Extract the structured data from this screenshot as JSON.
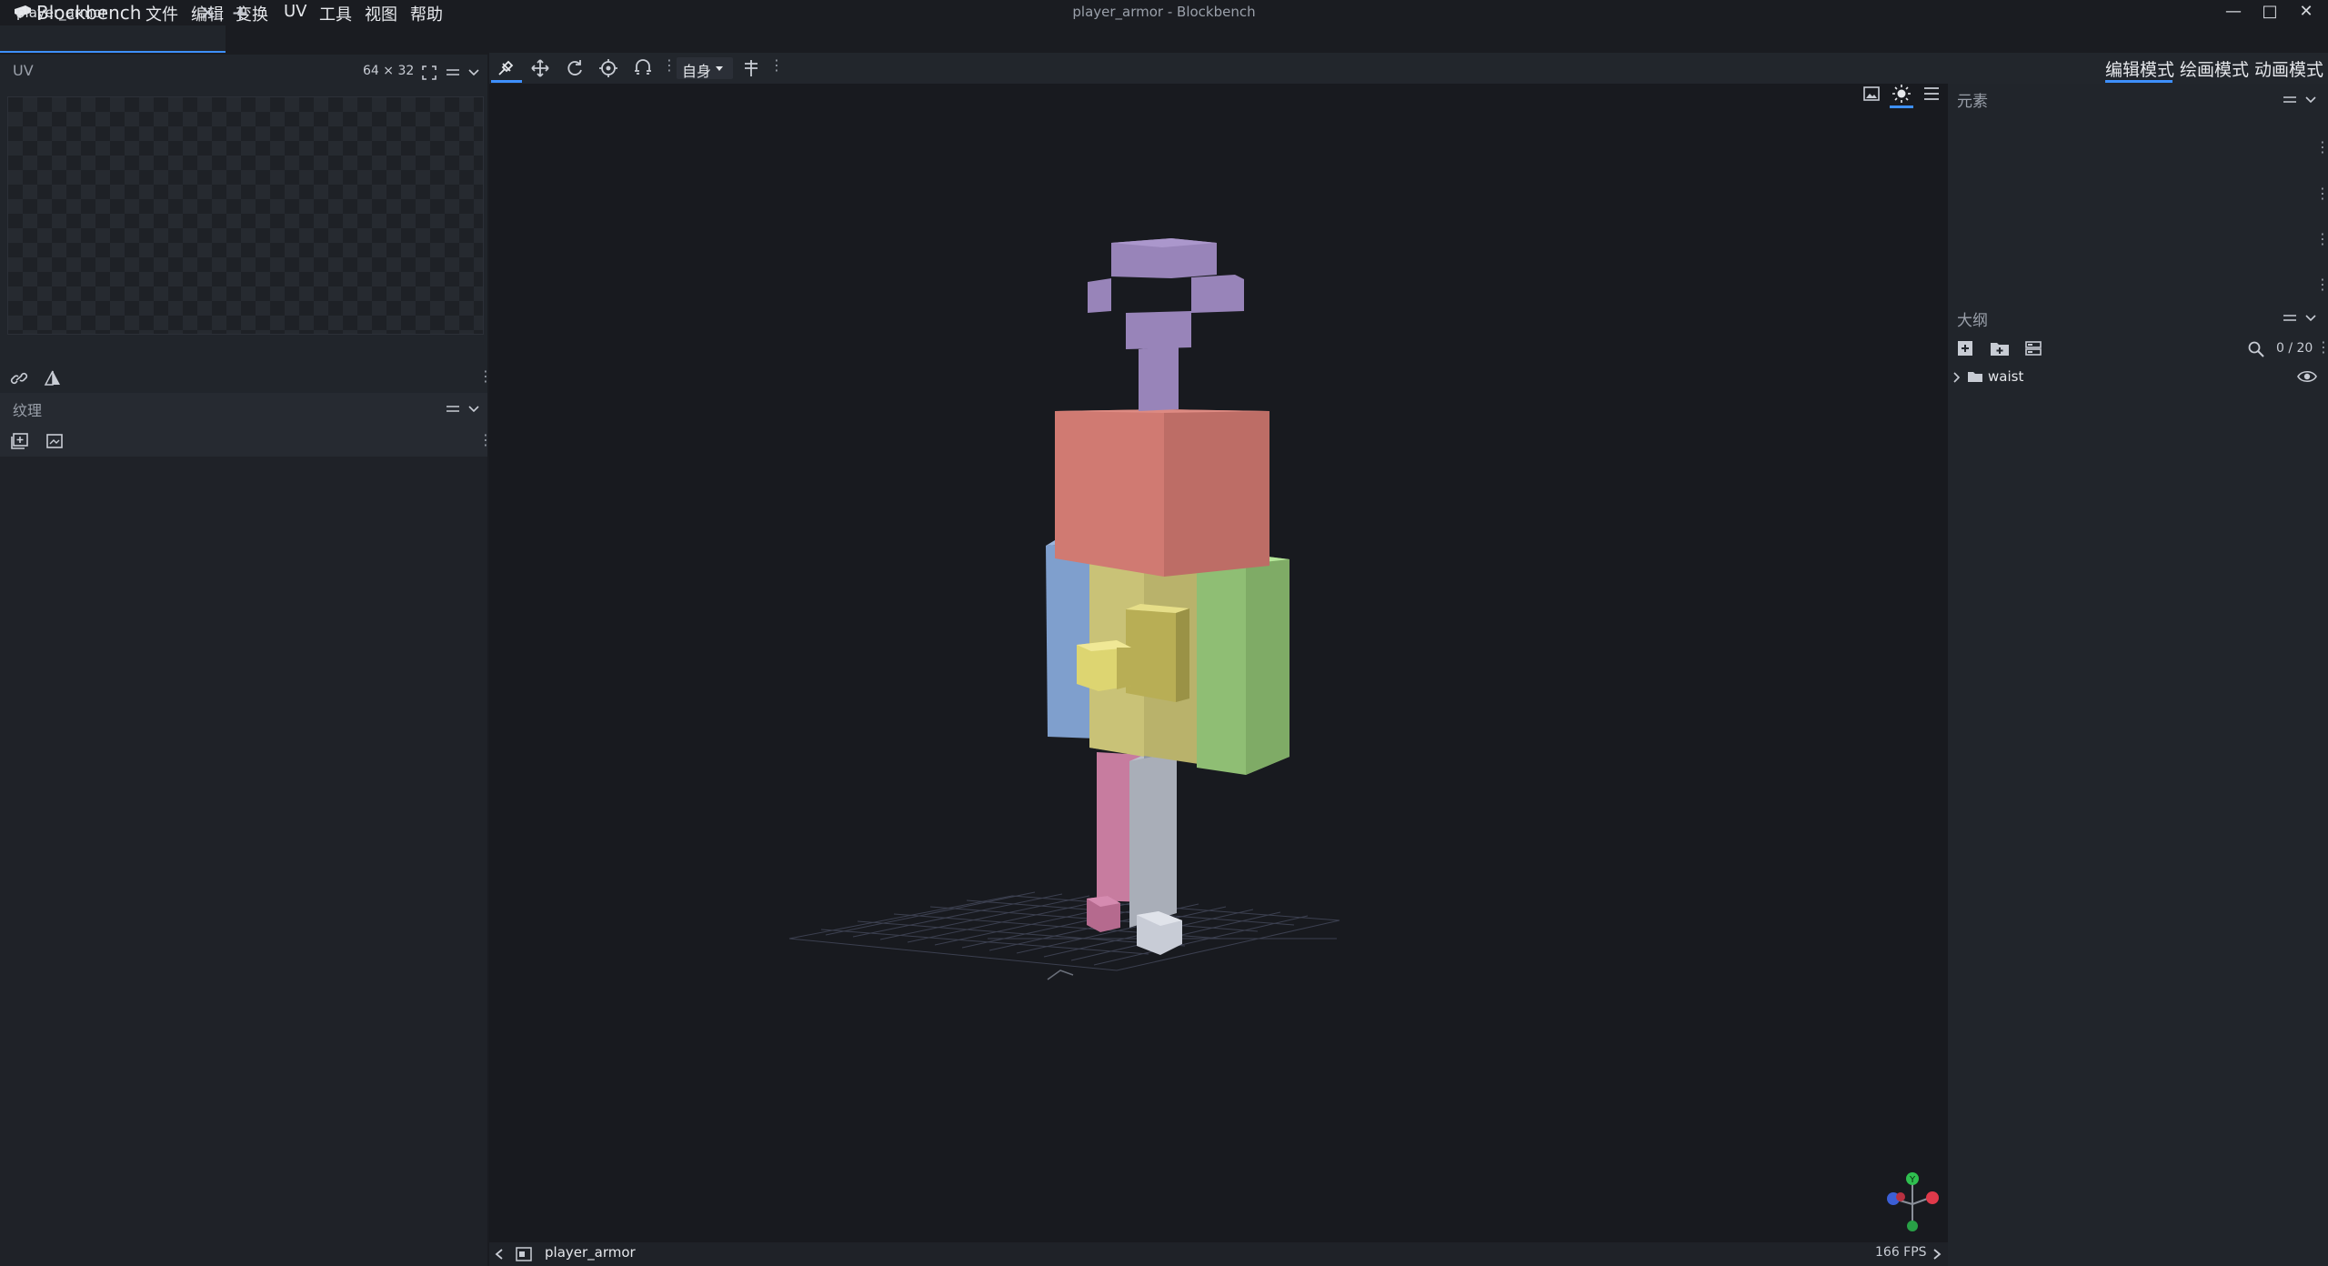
{
  "app": {
    "name": "Blockbench",
    "window_title": "player_armor - Blockbench",
    "menu": [
      "文件",
      "编辑",
      "变换",
      "UV",
      "工具",
      "视图",
      "帮助"
    ],
    "window_controls": [
      "minimize-icon",
      "maximize-icon",
      "close-icon"
    ]
  },
  "tabs": {
    "items": [
      {
        "label": "player_armor"
      }
    ],
    "add_label": "+"
  },
  "uv_panel": {
    "title": "UV",
    "size": "64 × 32"
  },
  "texture_panel": {
    "title": "纹理"
  },
  "toolbar": {
    "tools": [
      "move-tool-icon",
      "translate-icon",
      "rotate-icon",
      "pivot-icon",
      "vertex-snap-icon"
    ],
    "space_select": "自身"
  },
  "modes": {
    "edit": "编辑模式",
    "paint": "绘画模式",
    "animate": "动画模式"
  },
  "elements_panel": {
    "title": "元素"
  },
  "outliner": {
    "title": "大纲",
    "count": "0 / 20",
    "items": [
      {
        "label": "waist"
      }
    ]
  },
  "status": {
    "file": "player_armor",
    "fps": "166 FPS"
  },
  "colors": {
    "accent": "#3e90ff",
    "background": "#181a1f",
    "panel": "#21252b"
  }
}
